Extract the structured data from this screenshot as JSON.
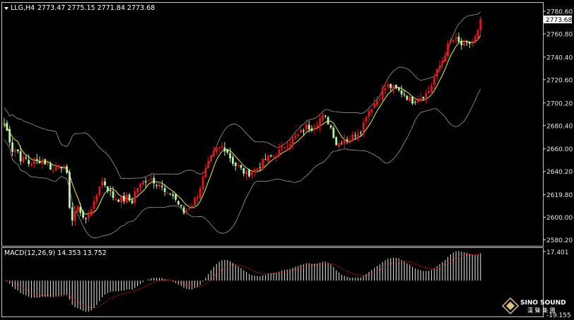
{
  "header": {
    "symbol": "LLG,H4",
    "ohlc": "2773.47 2775.15 2771.84 2773.68"
  },
  "macd": {
    "label": "MACD(12,26,9) 14.353 13.752",
    "axis_top": "17.401",
    "axis_bottom": "-19.155"
  },
  "current_price": "2773.68",
  "watermark": {
    "en": "SINO SOUND",
    "cn": "漢 聲 集 團"
  },
  "colors": {
    "background": "#000000",
    "bull": "#e8141c",
    "bear": "#b9f0a8",
    "ma": "#f2ec3a",
    "bands": "#9a9a9a",
    "macd_hist": "#d8d8d8",
    "macd_signal": "#e01818",
    "frame": "#c8c8c8"
  },
  "chart_data": {
    "type": "candlestick",
    "price_axis": {
      "ylim": [
        2575.6,
        2787.4
      ],
      "ticks": [
        "2780.60",
        "2760.80",
        "2740.40",
        "2720.60",
        "2700.20",
        "2680.40",
        "2660.00",
        "2640.20",
        "2619.80",
        "2600.00",
        "2580.20"
      ]
    },
    "candles_sample": [
      {
        "o": 2688,
        "h": 2695,
        "l": 2682,
        "c": 2692
      },
      {
        "o": 2692,
        "h": 2694,
        "l": 2660,
        "c": 2665
      },
      {
        "o": 2665,
        "h": 2668,
        "l": 2648,
        "c": 2652
      },
      {
        "o": 2650,
        "h": 2655,
        "l": 2585,
        "c": 2590
      },
      {
        "o": 2590,
        "h": 2600,
        "l": 2583,
        "c": 2596
      },
      {
        "o": 2615,
        "h": 2640,
        "l": 2610,
        "c": 2636
      },
      {
        "o": 2636,
        "h": 2640,
        "l": 2618,
        "c": 2622
      },
      {
        "o": 2605,
        "h": 2610,
        "l": 2597,
        "c": 2608
      },
      {
        "o": 2640,
        "h": 2665,
        "l": 2632,
        "c": 2662
      },
      {
        "o": 2645,
        "h": 2650,
        "l": 2625,
        "c": 2628
      },
      {
        "o": 2650,
        "h": 2672,
        "l": 2645,
        "c": 2668
      },
      {
        "o": 2690,
        "h": 2694,
        "l": 2680,
        "c": 2684
      },
      {
        "o": 2660,
        "h": 2668,
        "l": 2655,
        "c": 2664
      },
      {
        "o": 2700,
        "h": 2725,
        "l": 2695,
        "c": 2720
      },
      {
        "o": 2695,
        "h": 2706,
        "l": 2690,
        "c": 2702
      },
      {
        "o": 2725,
        "h": 2745,
        "l": 2720,
        "c": 2742
      },
      {
        "o": 2755,
        "h": 2765,
        "l": 2748,
        "c": 2760
      },
      {
        "o": 2760,
        "h": 2778,
        "l": 2755,
        "c": 2774
      }
    ],
    "macd_axis": {
      "ylim": [
        -19.155,
        17.401
      ]
    }
  }
}
